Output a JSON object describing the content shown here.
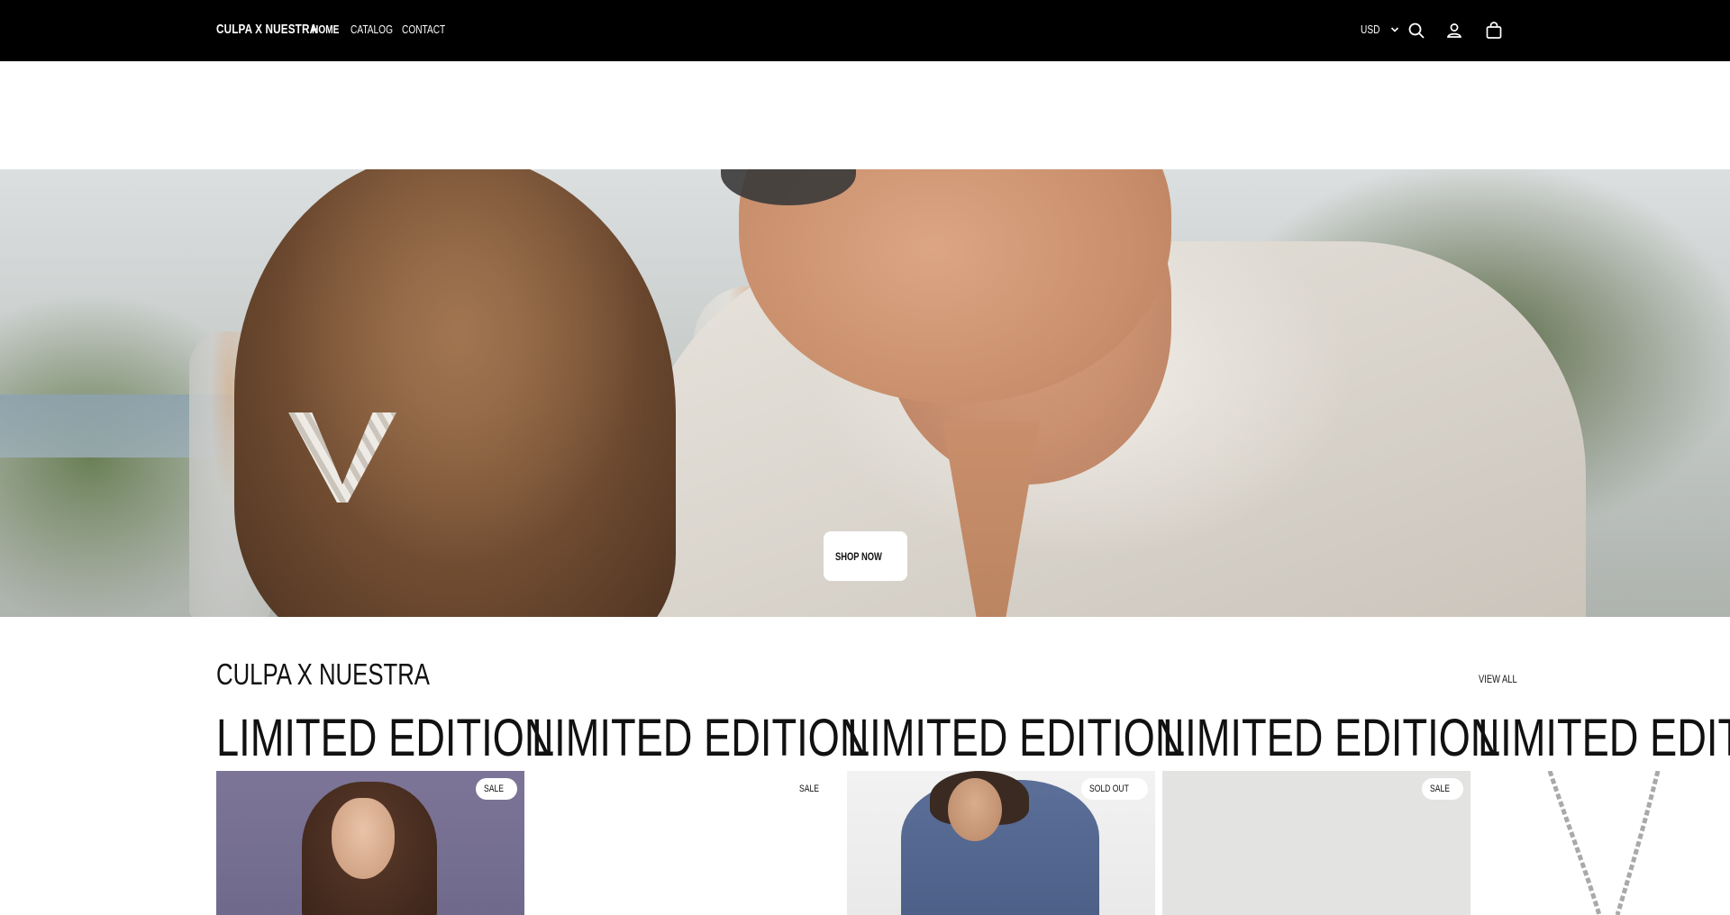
{
  "header": {
    "logo": "CULPA X NUESTRA",
    "nav": [
      {
        "label": "HOME"
      },
      {
        "label": "CATALOG"
      },
      {
        "label": "CONTACT"
      }
    ],
    "currency": "USD"
  },
  "hero": {
    "button_label": "SHOP NOW"
  },
  "collection": {
    "title": "CULPA X NUESTRA",
    "view_all": "VIEW ALL",
    "cards": [
      {
        "heading": "LIMITED EDITION",
        "badge": "SALE"
      },
      {
        "heading": "LIMITED EDITION",
        "badge": "SALE"
      },
      {
        "heading": "LIMITED EDITION",
        "badge": "SOLD OUT"
      },
      {
        "heading": "LIMITED EDITION",
        "badge": "SALE"
      },
      {
        "heading": "LIMITED EDITION"
      }
    ]
  },
  "colors": {
    "header_bg": "#000000",
    "accent": "#111111"
  },
  "icons": [
    "chevron-down-icon",
    "search-icon",
    "account-icon",
    "cart-icon"
  ]
}
